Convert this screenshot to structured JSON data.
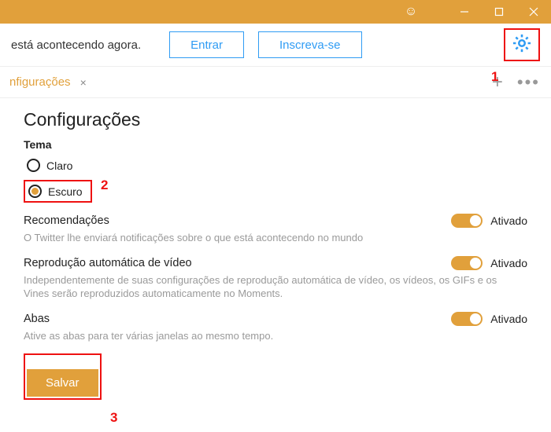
{
  "window": {
    "emoji": "☺"
  },
  "promo": {
    "text": "está acontecendo agora.",
    "login": "Entrar",
    "signup": "Inscreva-se"
  },
  "annotations": {
    "one": "1",
    "two": "2",
    "three": "3"
  },
  "tab": {
    "label": "nfigurações",
    "close": "×"
  },
  "page": {
    "title": "Configurações",
    "theme_label": "Tema",
    "theme_light": "Claro",
    "theme_dark": "Escuro",
    "rec_title": "Recomendações",
    "rec_desc": "O Twitter lhe enviará notificações sobre o que está acontecendo no mundo",
    "video_title": "Reprodução automática de vídeo",
    "video_desc": "Independentemente de suas configurações de reprodução automática de vídeo, os vídeos, os GIFs e os Vines serão reproduzidos automaticamente no Moments.",
    "tabs_title": "Abas",
    "tabs_desc": "Ative as abas para ter várias janelas ao mesmo tempo.",
    "on_label": "Ativado",
    "save": "Salvar"
  }
}
